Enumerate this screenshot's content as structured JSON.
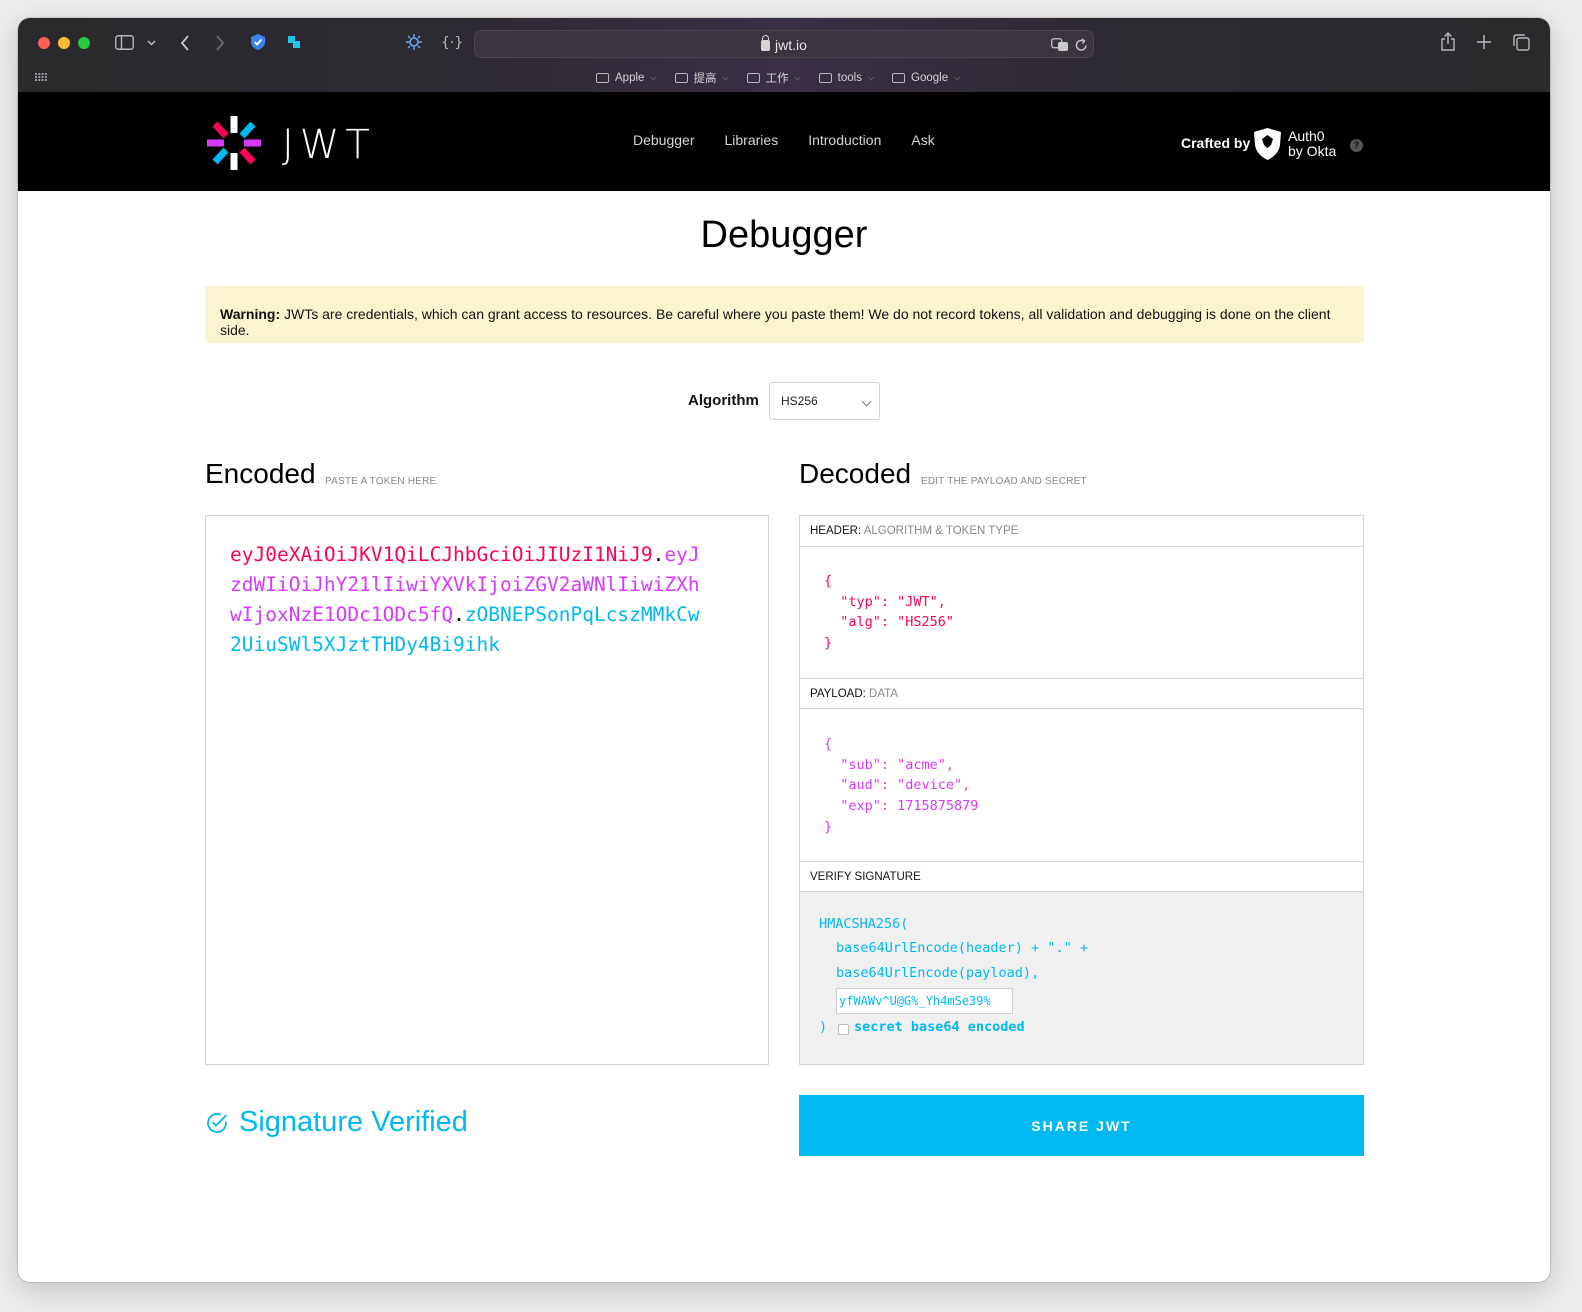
{
  "browser": {
    "url": "jwt.io",
    "bookmarks": [
      {
        "label": "Apple"
      },
      {
        "label": "提高"
      },
      {
        "label": "工作"
      },
      {
        "label": "tools"
      },
      {
        "label": "Google"
      }
    ]
  },
  "header": {
    "logo_text": "JWT",
    "nav": [
      "Debugger",
      "Libraries",
      "Introduction",
      "Ask"
    ],
    "crafted_by": "Crafted by",
    "auth0_line1": "Auth0",
    "auth0_line2": "by Okta"
  },
  "page": {
    "title": "Debugger",
    "warning_bold": "Warning:",
    "warning_text": " JWTs are credentials, which can grant access to resources. Be careful where you paste them! We do not record tokens, all validation and debugging is done on the client side."
  },
  "algorithm": {
    "label": "Algorithm",
    "selected": "HS256"
  },
  "encoded": {
    "title": "Encoded",
    "subtitle": "PASTE A TOKEN HERE",
    "token_header": "eyJ0eXAiOiJKV1QiLCJhbGciOiJIUzI1NiJ9",
    "token_payload": "eyJzdWIiOiJhY21lIiwiYXVkIjoiZGV2aWNlIiwiZXhwIjoxNzE1ODc1ODc5fQ",
    "token_signature": "zOBNEPSonPqLcszMMkCw2UiuSWl5XJztTHDy4Bi9ihk",
    "dot": "."
  },
  "decoded": {
    "title": "Decoded",
    "subtitle": "EDIT THE PAYLOAD AND SECRET",
    "header_label": "HEADER:",
    "header_sub": "ALGORITHM & TOKEN TYPE",
    "header_json": "{\n  \"typ\": \"JWT\",\n  \"alg\": \"HS256\"\n}",
    "payload_label": "PAYLOAD:",
    "payload_sub": "DATA",
    "payload_json": "{\n  \"sub\": \"acme\",\n  \"aud\": \"device\",\n  \"exp\": 1715875879\n}",
    "verify_label": "VERIFY SIGNATURE",
    "sig_fn": "HMACSHA256(",
    "sig_line1": "base64UrlEncode(header) + \".\" +",
    "sig_line2": "base64UrlEncode(payload),",
    "secret_value": "yfWAWv^U@G%_Yh4mSe39%",
    "sig_close": ")",
    "b64_label": "secret base64 encoded"
  },
  "status": {
    "verified_text": "Signature Verified",
    "share_label": "SHARE JWT"
  },
  "colors": {
    "header_red": "#fb015b",
    "payload_purple": "#d63aff",
    "signature_blue": "#00b9f1",
    "warning_bg": "#fbf5cf"
  }
}
